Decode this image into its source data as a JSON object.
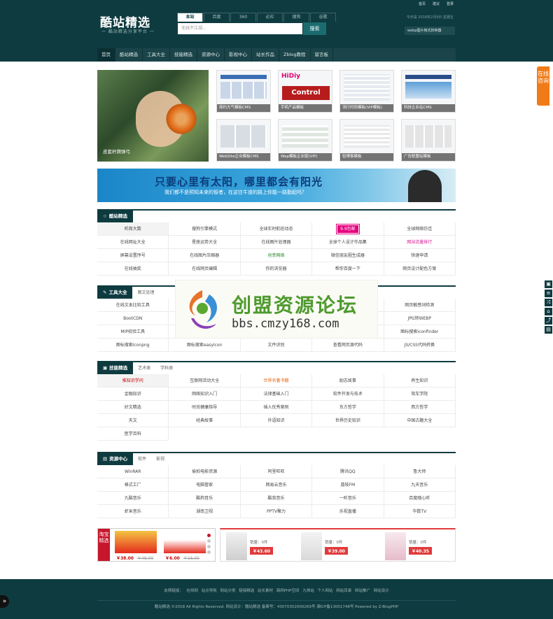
{
  "header": {
    "logo": "酷站精选",
    "slogan": "一 酷站精选分享平台 一",
    "search_tabs": [
      "本站",
      "百度",
      "360",
      "必应",
      "搜狗",
      "谷歌"
    ],
    "search_placeholder": "无线不江湖...",
    "search_button": "搜索",
    "top_links": [
      "首页",
      "建议",
      "登录"
    ],
    "date": "今天是 2018年2月9日 星期五",
    "notice": "webp图片格式转换器"
  },
  "nav": [
    "首页",
    "酷站精选",
    "工具大全",
    "技能精选",
    "资源中心",
    "影视中心",
    "站长作品",
    "Zblog教程",
    "留言板"
  ],
  "slider": {
    "caption": "皮套杆牌弹弓"
  },
  "thumbs": [
    {
      "caption": "简约大气模板CMS"
    },
    {
      "caption": "手机产品模板"
    },
    {
      "caption": "流行时尚模板(VIP模板)"
    },
    {
      "caption": "科技企业站CMS"
    },
    {
      "caption": "WebSite企业模板CMS"
    },
    {
      "caption": "Wap模板企业版(VIP)"
    },
    {
      "caption": "轻博客模板"
    },
    {
      "caption": "广告联盟站模板"
    }
  ],
  "thumb_ctrl_label": "Control",
  "thumb_hidiy": "HiDiy",
  "banner": {
    "line1": "只要心里有太阳，哪里都会有阳光",
    "line2": "我们都不是预知未来的智者，在这往牛道的路上你能一路勤起吗？"
  },
  "sections": [
    {
      "title": "酷站精选",
      "icon": "☆",
      "tabs": [],
      "cells": [
        {
          "t": "听商大数",
          "c": "hl"
        },
        {
          "t": "搜狗引擎模式",
          "c": ""
        },
        {
          "t": "全球实时航班动态",
          "c": ""
        },
        {
          "t": "9.9包邮",
          "c": "badge"
        },
        {
          "t": "全球网络仿佳",
          "c": ""
        },
        {
          "t": "在线网址大全",
          "c": ""
        },
        {
          "t": "星座运势大全",
          "c": ""
        },
        {
          "t": "在线图片处理器",
          "c": ""
        },
        {
          "t": "全球个人设计作品集",
          "c": ""
        },
        {
          "t": "网站流量排行",
          "c": "mag"
        },
        {
          "t": "屏幕设置序号",
          "c": ""
        },
        {
          "t": "在线图片压缩器",
          "c": ""
        },
        {
          "t": "创意网络",
          "c": "grn"
        },
        {
          "t": "微信朋友圈生成器",
          "c": ""
        },
        {
          "t": "快速申请",
          "c": ""
        },
        {
          "t": "在线抽奖",
          "c": ""
        },
        {
          "t": "在线网页编辑",
          "c": ""
        },
        {
          "t": "你的浏览器",
          "c": ""
        },
        {
          "t": "帮你百度一下",
          "c": ""
        },
        {
          "t": "网页设计配色方案",
          "c": ""
        }
      ]
    },
    {
      "title": "工具大全",
      "icon": "✎",
      "tabs": [
        "图文处理"
      ],
      "cells": [
        {
          "t": "在线文本比较工具",
          "c": ""
        },
        {
          "t": "",
          "c": ""
        },
        {
          "t": "",
          "c": ""
        },
        {
          "t": "",
          "c": ""
        },
        {
          "t": "网页敏感词检测",
          "c": ""
        },
        {
          "t": "BootCDN",
          "c": ""
        },
        {
          "t": "",
          "c": ""
        },
        {
          "t": "",
          "c": ""
        },
        {
          "t": "",
          "c": ""
        },
        {
          "t": "JPG转WEBP",
          "c": ""
        },
        {
          "t": "MIP校验工具",
          "c": ""
        },
        {
          "t": "",
          "c": ""
        },
        {
          "t": "",
          "c": ""
        },
        {
          "t": "",
          "c": ""
        },
        {
          "t": "图标搜索iconfinder",
          "c": ""
        },
        {
          "t": "图标搜索iconpng",
          "c": ""
        },
        {
          "t": "图标搜索easyicon",
          "c": ""
        },
        {
          "t": "文件识别",
          "c": ""
        },
        {
          "t": "查看网页源代码",
          "c": ""
        },
        {
          "t": "JS/CSS代码转换",
          "c": ""
        }
      ]
    },
    {
      "title": "技能精选",
      "icon": "▣",
      "tabs": [
        "艺术类",
        "学科类"
      ],
      "cells": [
        {
          "t": "推知识学问",
          "c": "hl red"
        },
        {
          "t": "互联网活动大全",
          "c": ""
        },
        {
          "t": "世界名著书籍",
          "c": "org"
        },
        {
          "t": "励志故事",
          "c": ""
        },
        {
          "t": "养生知识",
          "c": ""
        },
        {
          "t": "金融知识",
          "c": ""
        },
        {
          "t": "网络知识入门",
          "c": ""
        },
        {
          "t": "法律基础入门",
          "c": ""
        },
        {
          "t": "软件开发与技术",
          "c": ""
        },
        {
          "t": "驾车学院",
          "c": ""
        },
        {
          "t": "好文精选",
          "c": ""
        },
        {
          "t": "时尚健康指导",
          "c": ""
        },
        {
          "t": "插入优秀案例",
          "c": ""
        },
        {
          "t": "东方哲学",
          "c": ""
        },
        {
          "t": "西方哲学",
          "c": ""
        },
        {
          "t": "天文",
          "c": ""
        },
        {
          "t": "经典故事",
          "c": ""
        },
        {
          "t": "外语知识",
          "c": ""
        },
        {
          "t": "世界历史知识",
          "c": ""
        },
        {
          "t": "中国古籍大全",
          "c": ""
        },
        {
          "t": "医学百科",
          "c": ""
        }
      ]
    },
    {
      "title": "资源中心",
      "icon": "▤",
      "tabs": [
        "软件",
        "影视"
      ],
      "cells": [
        {
          "t": "WinRAR",
          "c": ""
        },
        {
          "t": "偷拍电影资源",
          "c": ""
        },
        {
          "t": "阿里旺旺",
          "c": ""
        },
        {
          "t": "腾讯QQ",
          "c": ""
        },
        {
          "t": "鲁大师",
          "c": ""
        },
        {
          "t": "格式工厂",
          "c": ""
        },
        {
          "t": "电脑管家",
          "c": ""
        },
        {
          "t": "网易云音乐",
          "c": ""
        },
        {
          "t": "荔枝FM",
          "c": ""
        },
        {
          "t": "九天音乐",
          "c": ""
        },
        {
          "t": "九酷音乐",
          "c": ""
        },
        {
          "t": "酷狗音乐",
          "c": ""
        },
        {
          "t": "酷我音乐",
          "c": ""
        },
        {
          "t": "一听音乐",
          "c": ""
        },
        {
          "t": "百度随心听",
          "c": ""
        },
        {
          "t": "虾米音乐",
          "c": ""
        },
        {
          "t": "湖南卫视",
          "c": ""
        },
        {
          "t": "PPTV聚力",
          "c": ""
        },
        {
          "t": "乐视直播",
          "c": ""
        },
        {
          "t": "华数TV",
          "c": ""
        }
      ]
    }
  ],
  "watermark": {
    "title": "创盟资源论坛",
    "url": "bbs.cmzy168.com"
  },
  "promo_left": {
    "tag": "淘宝精选",
    "items": [
      {
        "price": "￥38.00",
        "old": "￥48.00"
      },
      {
        "price": "￥6.00",
        "old": "￥16.00"
      }
    ]
  },
  "promo_right": {
    "items": [
      {
        "sales": "销量：0件",
        "price": "￥43.60"
      },
      {
        "sales": "销量：0件",
        "price": "￥39.00"
      },
      {
        "sales": "销量：0件",
        "price": "￥40.35"
      }
    ]
  },
  "footer": {
    "links": "友情链接： 在线网 站点导航 网站分类 链接精选 站长素材 简网PHP空间 九帅站 个人网站 网站目录 网站推广 网站设计",
    "copyright": "酷站精选 ©2018 All Rights Reserved. 网站设计：酷站精选 备案号：43070302000269号 湘ICP备13001748号 Powered by Z-BlogPHP"
  },
  "online_service": "在线咨询",
  "sidebar_icons": [
    "▣",
    "≡",
    "⤮",
    "⌂",
    "⤴",
    "▤"
  ],
  "colors": {
    "primary": "#0e3b40",
    "accent": "#f07b18",
    "red": "#c7162b"
  }
}
